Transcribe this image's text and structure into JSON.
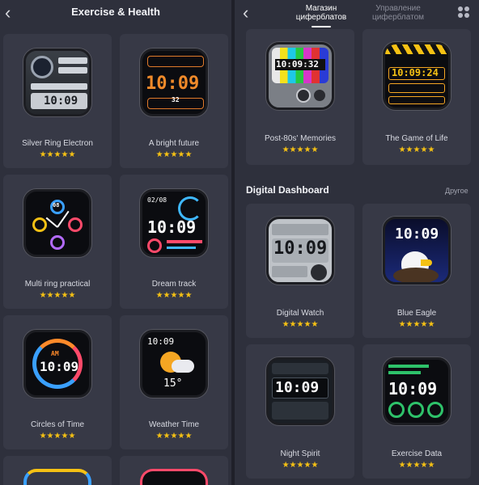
{
  "left_panel": {
    "title": "Exercise & Health",
    "faces": [
      {
        "name": "Silver Ring Electron",
        "stars": "★★★★★",
        "time": "10:09",
        "small": "32"
      },
      {
        "name": "A bright future",
        "stars": "★★★★★",
        "time": "10:09",
        "small": "32"
      },
      {
        "name": "Multi ring practical",
        "stars": "★★★★★",
        "time": "",
        "small": "08"
      },
      {
        "name": "Dream track",
        "stars": "★★★★★",
        "time": "10:09",
        "small": "02/08"
      },
      {
        "name": "Circles of Time",
        "stars": "★★★★★",
        "time": "10:09",
        "small": "AM"
      },
      {
        "name": "Weather Time",
        "stars": "★★★★★",
        "time": "10:09",
        "small": "15°"
      }
    ]
  },
  "right_panel": {
    "tabs": [
      {
        "label": "Магазин циферблатов"
      },
      {
        "label": "Управление циферблатом"
      }
    ],
    "top_faces": [
      {
        "name": "Post-80s' Memories",
        "stars": "★★★★★",
        "time": "10:09:32"
      },
      {
        "name": "The Game of Life",
        "stars": "★★★★★",
        "time": "10:09:24"
      }
    ],
    "section": {
      "title": "Digital Dashboard",
      "more": "Другое"
    },
    "faces": [
      {
        "name": "Digital Watch",
        "stars": "★★★★★",
        "time": "10:09"
      },
      {
        "name": "Blue Eagle",
        "stars": "★★★★★",
        "time": "10:09"
      },
      {
        "name": "Night Spirit",
        "stars": "★★★★★",
        "time": "10:09"
      },
      {
        "name": "Exercise Data",
        "stars": "★★★★★",
        "time": "10:09"
      }
    ]
  },
  "colors": {
    "background": "#2e303c",
    "card": "#373946",
    "star": "#f5c114"
  },
  "icons": {
    "back": "chevron-left-icon",
    "grid": "grid-dots-icon"
  }
}
